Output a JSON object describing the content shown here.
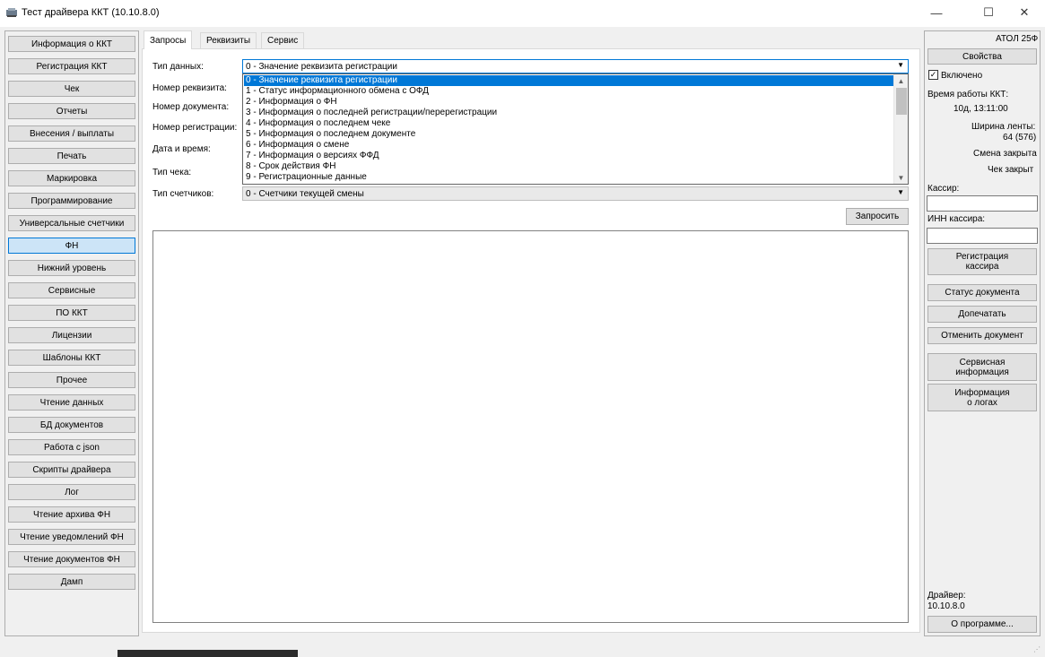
{
  "window": {
    "title": "Тест драйвера ККТ (10.10.8.0)",
    "minimize_glyph": "—",
    "maximize_glyph": "☐",
    "close_glyph": "✕"
  },
  "leftnav": {
    "items": [
      "Информация о ККТ",
      "Регистрация ККТ",
      "Чек",
      "Отчеты",
      "Внесения / выплаты",
      "Печать",
      "Маркировка",
      "Программирование",
      "Универсальные счетчики",
      "ФН",
      "Нижний уровень",
      "Сервисные",
      "ПО ККТ",
      "Лицензии",
      "Шаблоны ККТ",
      "Прочее",
      "Чтение данных",
      "БД документов",
      "Работа с json",
      "Скрипты драйвера",
      "Лог",
      "Чтение архива ФН",
      "Чтение уведомлений ФН",
      "Чтение документов ФН",
      "Дамп"
    ],
    "active": "ФН"
  },
  "tabs": [
    "Запросы",
    "Реквизиты",
    "Сервис"
  ],
  "form": {
    "labels": {
      "data_type": "Тип данных:",
      "requisite_number": "Номер реквизита:",
      "document_number": "Номер документа:",
      "registration_number": "Номер регистрации:",
      "date_time": "Дата и время:",
      "receipt_type": "Тип чека:",
      "counters_type": "Тип счетчиков:"
    },
    "data_type_value": "0 - Значение реквизита регистрации",
    "counters_type_value": "0 - Счетчики текущей смены",
    "request_button": "Запросить"
  },
  "dropdown": {
    "options": [
      "0 - Значение реквизита регистрации",
      "1 - Статус информационного обмена с ОФД",
      "2 - Информация о ФН",
      "3 - Информация о последней регистрации/перерегистрации",
      "4 - Информация о последнем чеке",
      "5 - Информация о последнем документе",
      "6 - Информация о смене",
      "7 - Информация о версиях ФФД",
      "8 - Срок действия ФН",
      "9 - Регистрационные данные"
    ],
    "selected_index": 0
  },
  "right_panel": {
    "model": "АТОЛ 25Ф",
    "properties_button": "Свойства",
    "enabled_label": "Включено",
    "enabled": true,
    "uptime_label": "Время работы ККТ:",
    "uptime_value": "10д, 13:11:00",
    "tape_width_label": "Ширина ленты:",
    "tape_width_value": "64 (576)",
    "shift_status": "Смена закрыта",
    "receipt_status": "Чек закрыт",
    "cashier_label": "Кассир:",
    "cashier_inn_label": "ИНН кассира:",
    "register_cashier_line1": "Регистрация",
    "register_cashier_line2": "кассира",
    "document_status_button": "Статус документа",
    "reprint_button": "Допечатать",
    "cancel_document_button": "Отменить документ",
    "service_info_line1": "Сервисная",
    "service_info_line2": "информация",
    "logs_info_line1": "Информация",
    "logs_info_line2": "о логах",
    "driver_label": "Драйвер:",
    "driver_version": "10.10.8.0",
    "about_button": "О программе..."
  }
}
